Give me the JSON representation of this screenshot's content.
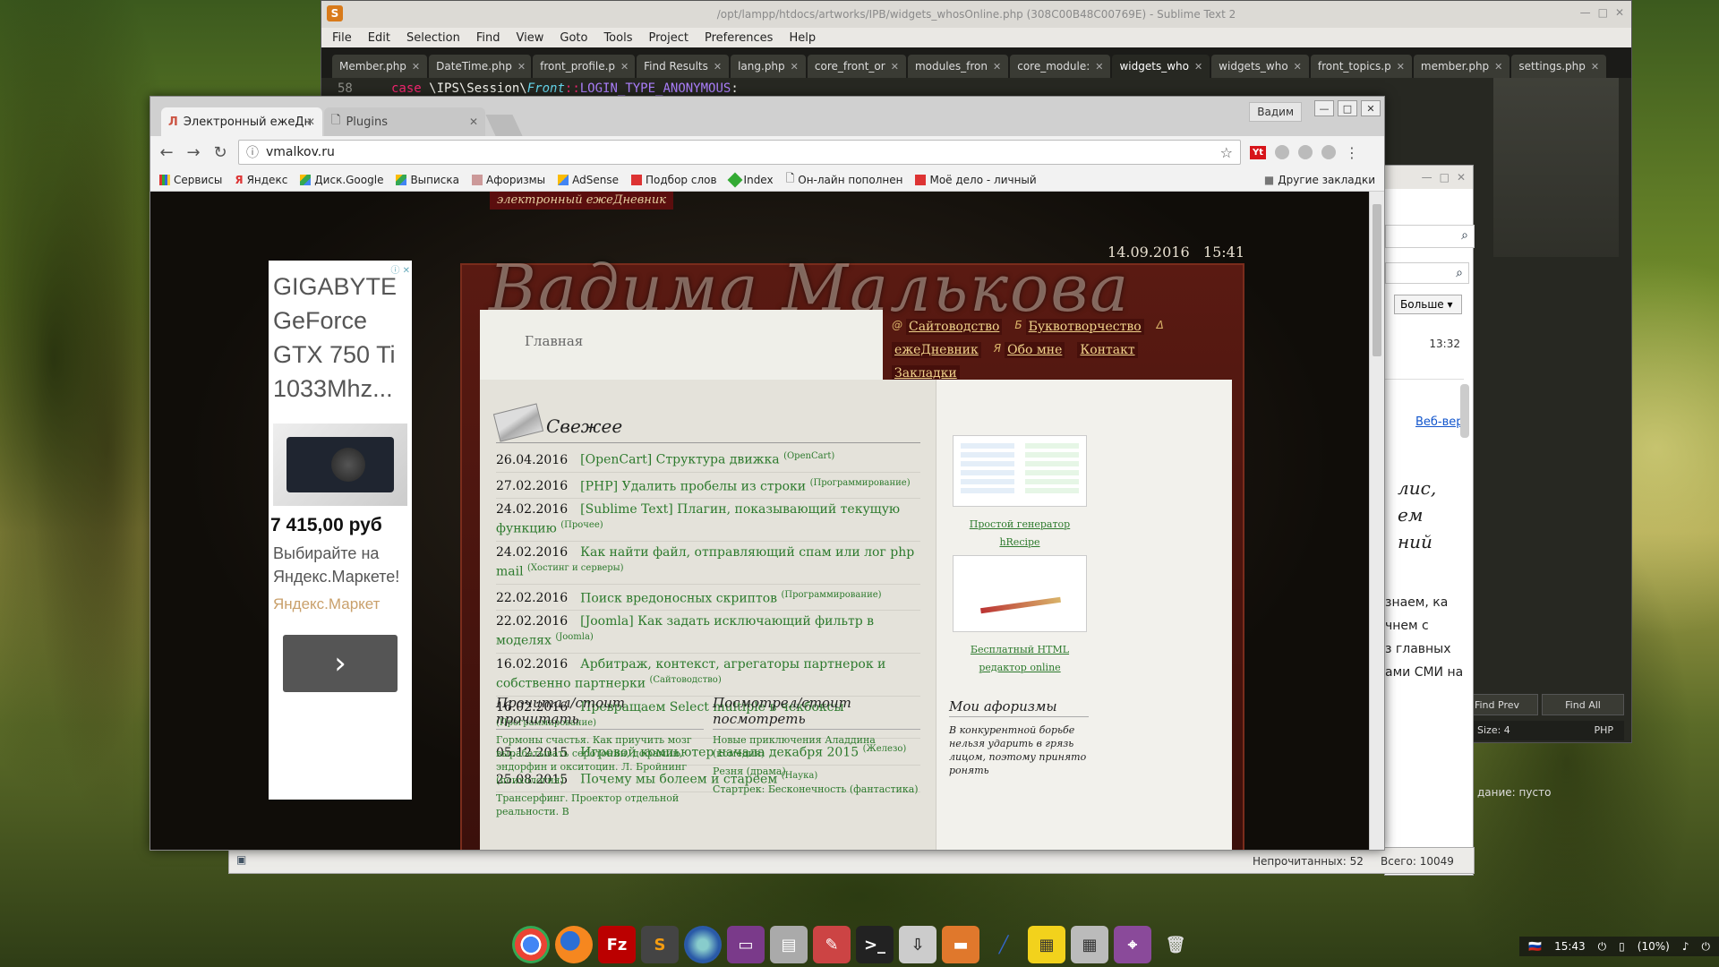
{
  "sublime": {
    "title": "/opt/lampp/htdocs/artworks/IPB/widgets_whosOnline.php (308C00B48C00769E) - Sublime Text 2",
    "menu": [
      "File",
      "Edit",
      "Selection",
      "Find",
      "View",
      "Goto",
      "Tools",
      "Project",
      "Preferences",
      "Help"
    ],
    "tabs": [
      "Member.php",
      "DateTime.php",
      "front_profile.p",
      "Find Results",
      "lang.php",
      "core_front_or",
      "modules_fron",
      "core_module:",
      "widgets_who",
      "widgets_who",
      "front_topics.p",
      "member.php",
      "settings.php"
    ],
    "active_tab_index": 8,
    "code_line_number": "58",
    "code_keyword": "case",
    "code_ns_1": "\\IPS\\Session\\",
    "code_class": "Front",
    "code_sep": "::",
    "code_const": "LOGIN_TYPE_ANONYMOUS",
    "code_end": ":",
    "find_prev": "Find Prev",
    "find_all": "Find All",
    "status_left": "Size: 4",
    "status_right": "PHP"
  },
  "mail": {
    "more_label": "Больше",
    "time": "13:32",
    "link": "Веб-вер",
    "italic_lines": [
      "лис,",
      "ем",
      "ний"
    ],
    "text_lines": [
      "знаем, ка",
      "чнем с",
      "з главных",
      "ами СМИ на"
    ],
    "status_empty": "дание: пусто",
    "unread": "Непрочитанных: 52",
    "total": "Всего: 10049"
  },
  "chrome": {
    "tabs": [
      {
        "title": "Электронный ежеДн",
        "active": true
      },
      {
        "title": "Plugins",
        "active": false
      }
    ],
    "user": "Вадим",
    "url": "vmalkov.ru",
    "bookmarks": [
      "Сервисы",
      "Яндекс",
      "Диск.Google",
      "Выписка",
      "Афоризмы",
      "AdSense",
      "Подбор слов",
      "Index",
      "Он-лайн пополнен",
      "Моё дело - личный"
    ],
    "other_bookmarks": "Другие закладки"
  },
  "site": {
    "top_tag": "электронный ежеДневник",
    "date": "14.09.2016",
    "time": "15:41",
    "logo_text": "Вадима Малькова",
    "home": "Главная",
    "nav": [
      {
        "sym": "@",
        "label": "Сайтоводство"
      },
      {
        "sym": "Б",
        "label": "Буквотворчество"
      },
      {
        "sym": "Δ",
        "label": "ежеДневник"
      },
      {
        "sym": "Я",
        "label": "Обо мне"
      },
      {
        "sym": "",
        "label": "Контакт"
      },
      {
        "sym": "",
        "label": "Закладки"
      }
    ],
    "fresh_title": "Свежее",
    "news": [
      {
        "date": "26.04.2016",
        "title": "[OpenCart] Структура движка",
        "cat": "(OpenCart)"
      },
      {
        "date": "27.02.2016",
        "title": "[PHP] Удалить пробелы из строки",
        "cat": "(Программирование)"
      },
      {
        "date": "24.02.2016",
        "title": "[Sublime Text] Плагин, показывающий текущую функцию",
        "cat": "(Прочее)"
      },
      {
        "date": "24.02.2016",
        "title": "Как найти файл, отправляющий спам или лог php mail",
        "cat": "(Хостинг и серверы)"
      },
      {
        "date": "22.02.2016",
        "title": "Поиск вредоносных скриптов",
        "cat": "(Программирование)"
      },
      {
        "date": "22.02.2016",
        "title": "[Joomla] Как задать исключающий фильтр в моделях",
        "cat": "(Joomla)"
      },
      {
        "date": "16.02.2016",
        "title": "Арбитраж, контекст, агрегаторы партнерок и собственно партнерки",
        "cat": "(Сайтоводство)"
      },
      {
        "date": "16.02.2016",
        "title": "Превращаем Select multiple в чекбоксы",
        "cat": "(Программирование)"
      },
      {
        "date": "05.12.2015",
        "title": "Игровой компьютер начала декабря 2015",
        "cat": "(Железо)"
      },
      {
        "date": "25.08.2015",
        "title": "Почему мы болеем и стареем",
        "cat": "(Наука)"
      }
    ],
    "read_title": "Прочитал/стоит прочитать",
    "read_items": [
      "Гормоны счастья. Как приучить мозг вырабатывать серотонин, дофамин, эндорфин и окситоцин. Л. Бройнинг (психология)",
      "Трансерфинг. Проектор отдельной реальности. В"
    ],
    "watched_title": "Посмотрел/стоит посмотреть",
    "watched_items": [
      "Новые приключения Аладдина (комедия)",
      "Резня (драма)",
      "Стартрек: Бесконечность (фантастика)"
    ],
    "cards": [
      {
        "link": "Простой генератор hRecipe"
      },
      {
        "link": "Бесплатный HTML редактор online"
      }
    ],
    "aph_title": "Мои афоризмы",
    "aph_text": "В конкурентной борьбе нельзя ударить в грязь лицом, поэтому принято ронять"
  },
  "ad": {
    "title": "GIGABYTE GeForce GTX 750 Ti 1033Mhz...",
    "price": "7 415,00 руб",
    "desc": "Выбирайте на Яндекс.Маркете!",
    "store": "Яндекс.Маркет"
  },
  "tray": {
    "time": "15:43",
    "battery": "(10%)"
  },
  "dock_icons": [
    "chrome-icon",
    "firefox-icon",
    "filezilla-icon",
    "sublime-icon",
    "thunderbird-icon",
    "screen-icon",
    "files-icon",
    "draw-icon",
    "terminal-icon",
    "install-icon",
    "folder-icon",
    "pen-icon",
    "ruler-icon",
    "calculator-icon",
    "screenshot-icon",
    "trash-icon"
  ],
  "colors": {
    "link_green": "#2d7a2d",
    "site_red": "#5a1a12",
    "nav_gold": "#f1d38b"
  }
}
